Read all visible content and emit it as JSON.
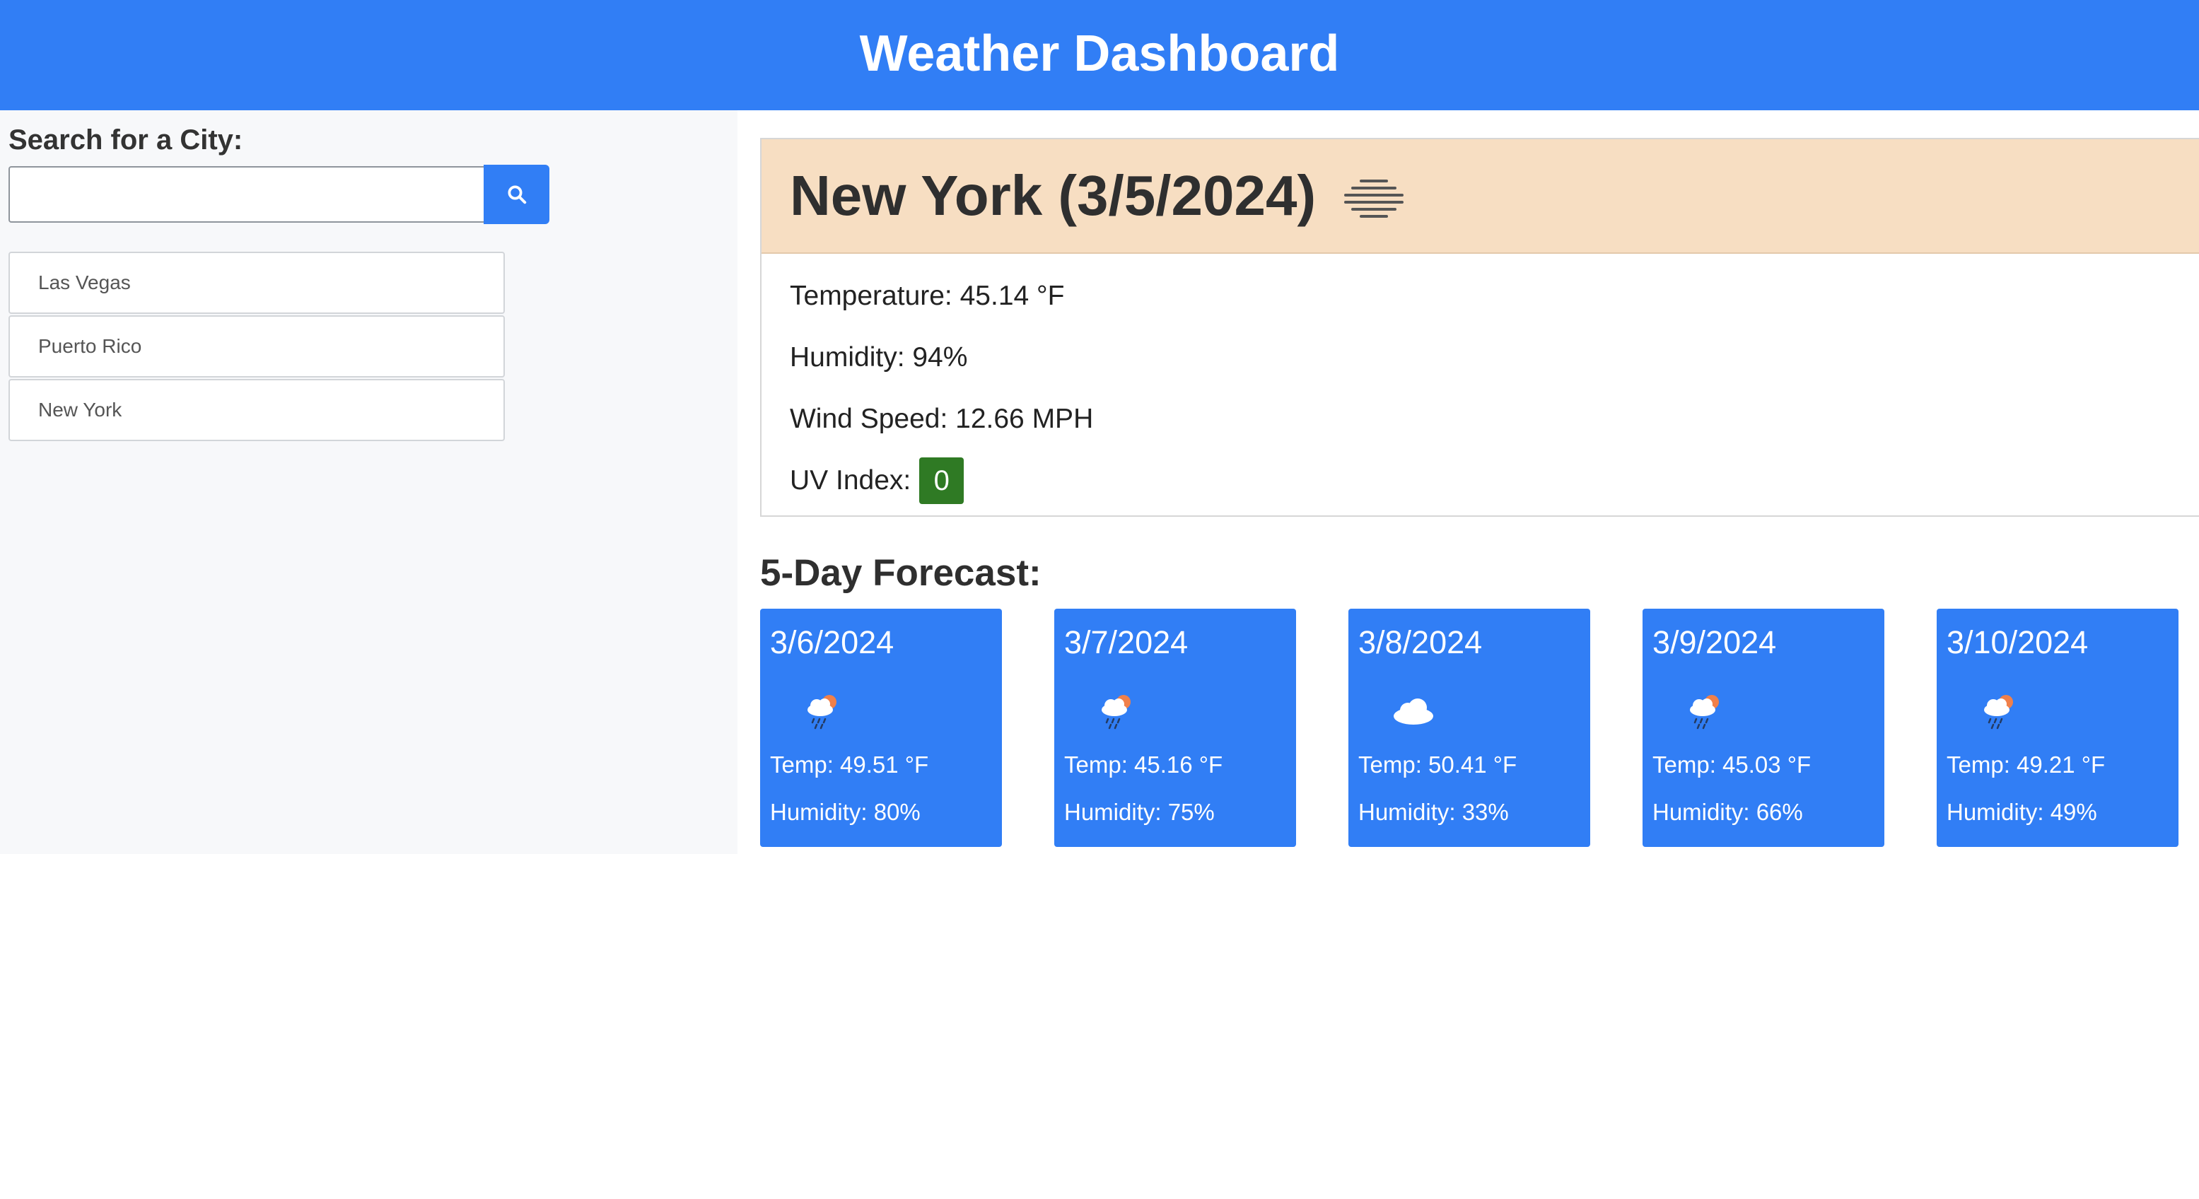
{
  "header": {
    "title": "Weather Dashboard"
  },
  "sidebar": {
    "search_label": "Search for a City:",
    "search_value": "",
    "history": [
      {
        "label": "Las Vegas"
      },
      {
        "label": "Puerto Rico"
      },
      {
        "label": "New York"
      }
    ]
  },
  "current": {
    "title": "New York (3/5/2024)",
    "icon": "mist-icon",
    "temperature": "Temperature: 45.14 °F",
    "humidity": "Humidity: 94%",
    "wind": "Wind Speed: 12.66 MPH",
    "uv_label": "UV Index:",
    "uv_value": "0",
    "uv_color": "#2f7a24"
  },
  "forecast": {
    "title": "5-Day Forecast:",
    "days": [
      {
        "date": "3/6/2024",
        "icon": "rain-sun-icon",
        "temp": "Temp: 49.51 °F",
        "humidity": "Humidity: 80%"
      },
      {
        "date": "3/7/2024",
        "icon": "rain-sun-icon",
        "temp": "Temp: 45.16 °F",
        "humidity": "Humidity: 75%"
      },
      {
        "date": "3/8/2024",
        "icon": "cloud-icon",
        "temp": "Temp: 50.41 °F",
        "humidity": "Humidity: 33%"
      },
      {
        "date": "3/9/2024",
        "icon": "rain-sun-icon",
        "temp": "Temp: 45.03 °F",
        "humidity": "Humidity: 66%"
      },
      {
        "date": "3/10/2024",
        "icon": "rain-sun-icon",
        "temp": "Temp: 49.21 °F",
        "humidity": "Humidity: 49%"
      }
    ]
  },
  "colors": {
    "primary": "#317ef5",
    "current_header_bg": "#f7dec2",
    "sidebar_bg": "#f7f8fa"
  }
}
